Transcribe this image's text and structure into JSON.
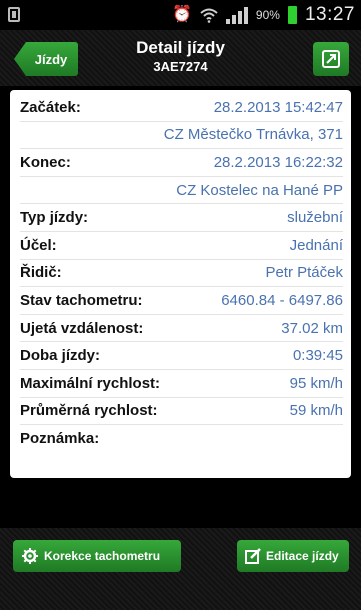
{
  "status_bar": {
    "battery_percent": "90%",
    "clock": "13:27",
    "icons": [
      "notification-icon",
      "alarm-icon",
      "wifi-icon",
      "signal-icon",
      "battery-icon"
    ]
  },
  "header": {
    "back_label": "Jízdy",
    "title": "Detail jízdy",
    "subtitle": "3AE7274",
    "export_icon": "export-icon"
  },
  "details": {
    "start_label": "Začátek:",
    "start_time": "28.2.2013 15:42:47",
    "start_place": "CZ Městečko Trnávka, 371",
    "end_label": "Konec:",
    "end_time": "28.2.2013 16:22:32",
    "end_place": "CZ Kostelec na Hané PP",
    "rows": [
      {
        "label": "Typ jízdy:",
        "value": "služební"
      },
      {
        "label": "Účel:",
        "value": "Jednání"
      },
      {
        "label": "Řidič:",
        "value": "Petr Ptáček"
      },
      {
        "label": "Stav tachometru:",
        "value": "6460.84 - 6497.86"
      },
      {
        "label": "Ujetá vzdálenost:",
        "value": "37.02 km"
      },
      {
        "label": "Doba jízdy:",
        "value": "0:39:45"
      },
      {
        "label": "Maximální rychlost:",
        "value": "95 km/h"
      },
      {
        "label": "Průměrná rychlost:",
        "value": "59 km/h"
      },
      {
        "label": "Poznámka:",
        "value": ""
      }
    ]
  },
  "bottom": {
    "left_label": "Korekce tachometru",
    "right_label": "Editace jízdy"
  },
  "colors": {
    "accent_green": "#2a9330",
    "value_blue": "#4a72b0"
  }
}
